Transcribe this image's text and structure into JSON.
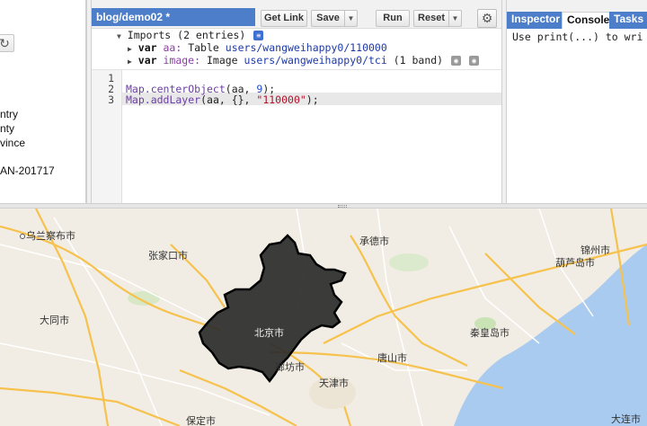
{
  "left_panel": {
    "items": [
      "ntry",
      "nty",
      "vince",
      "AN-201717"
    ]
  },
  "editor": {
    "file_title": "blog/demo02 *",
    "buttons": {
      "get_link": "Get Link",
      "save": "Save",
      "run": "Run",
      "reset": "Reset"
    },
    "imports_header": "Imports (2 entries)",
    "imports": [
      {
        "keyword": "var",
        "name": "aa:",
        "type": "Table",
        "path": "users/wangweihappy0/110000",
        "extra": ""
      },
      {
        "keyword": "var",
        "name": "image:",
        "type": "Image",
        "path": "users/wangweihappy0/tci",
        "extra": "(1 band)"
      }
    ],
    "line_numbers": [
      "1",
      "2",
      "3"
    ],
    "code": {
      "line2_fn": "Map.centerObject",
      "line2_args": "(aa, ",
      "line2_num": "9",
      "line2_end": ");",
      "line3_fn": "Map.addLayer",
      "line3_args": "(aa, {}, ",
      "line3_str": "\"110000\"",
      "line3_end": ");"
    }
  },
  "right_panel": {
    "tabs": [
      "Inspector",
      "Console",
      "Tasks"
    ],
    "active_tab": "Console",
    "console_text": "Use print(...) to wri"
  },
  "map": {
    "cities": [
      {
        "name": "乌兰察布市"
      },
      {
        "name": "张家口市"
      },
      {
        "name": "承德市"
      },
      {
        "name": "锦州市"
      },
      {
        "name": "葫芦岛市"
      },
      {
        "name": "大同市"
      },
      {
        "name": "北京市"
      },
      {
        "name": "秦皇岛市"
      },
      {
        "name": "唐山市"
      },
      {
        "name": "廊坊市"
      },
      {
        "name": "天津市"
      },
      {
        "name": "保定市"
      },
      {
        "name": "大连市"
      }
    ],
    "colors": {
      "land": "#f1ede4",
      "sea": "#a9cbf0",
      "highway": "#f6c24d",
      "road": "#ffffff",
      "park": "#c9e3b5",
      "boundary_fill": "#2b2b2b",
      "boundary_stroke": "#000000"
    }
  }
}
